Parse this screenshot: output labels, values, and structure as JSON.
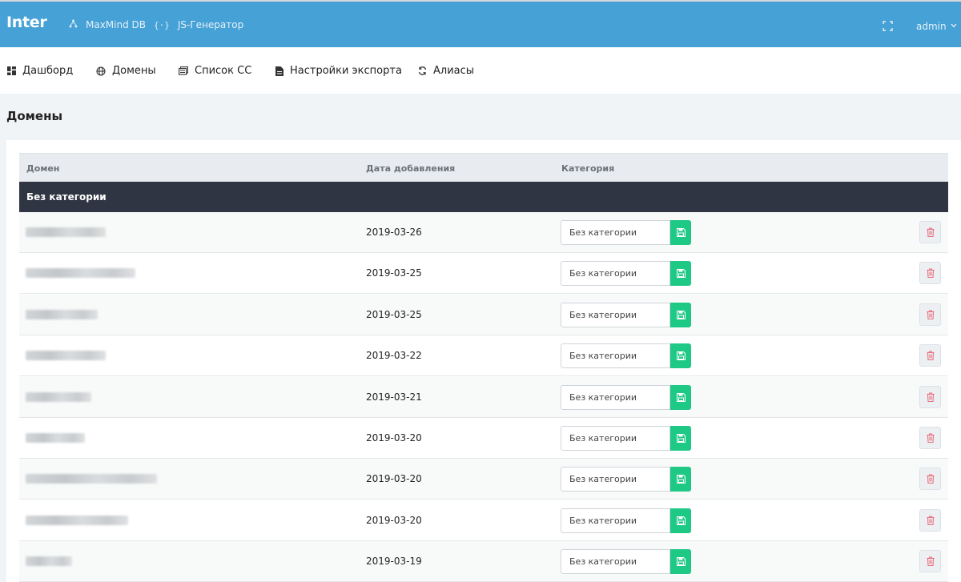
{
  "header": {
    "brand": "Inter",
    "links": [
      {
        "label": "MaxMind DB",
        "icon": "sitemap-icon"
      },
      {
        "label": "JS-Генератор",
        "icon": "code-braces-icon"
      }
    ],
    "fullscreen_icon": "fullscreen-icon",
    "user": "admin"
  },
  "nav": {
    "items": [
      {
        "label": "Дашборд",
        "icon": "dashboard-icon"
      },
      {
        "label": "Домены",
        "icon": "globe-icon"
      },
      {
        "label": "Список СС",
        "icon": "list-icon"
      },
      {
        "label": "Настройки экспорта",
        "icon": "file-icon"
      },
      {
        "label": "Алиасы",
        "icon": "sync-icon"
      }
    ]
  },
  "page": {
    "title": "Домены"
  },
  "table": {
    "columns": [
      "Домен",
      "Дата добавления",
      "Категория"
    ],
    "group_label": "Без категории",
    "rows": [
      {
        "date": "2019-03-26",
        "category": "Без категории"
      },
      {
        "date": "2019-03-25",
        "category": "Без категории"
      },
      {
        "date": "2019-03-25",
        "category": "Без категории"
      },
      {
        "date": "2019-03-22",
        "category": "Без категории"
      },
      {
        "date": "2019-03-21",
        "category": "Без категории"
      },
      {
        "date": "2019-03-20",
        "category": "Без категории"
      },
      {
        "date": "2019-03-20",
        "category": "Без категории"
      },
      {
        "date": "2019-03-20",
        "category": "Без категории"
      },
      {
        "date": "2019-03-19",
        "category": "Без категории"
      }
    ]
  },
  "colors": {
    "header_bg": "#45a1d6",
    "group_bg": "#2f3542",
    "save_button": "#1ec885",
    "delete_icon": "#e8707e"
  }
}
